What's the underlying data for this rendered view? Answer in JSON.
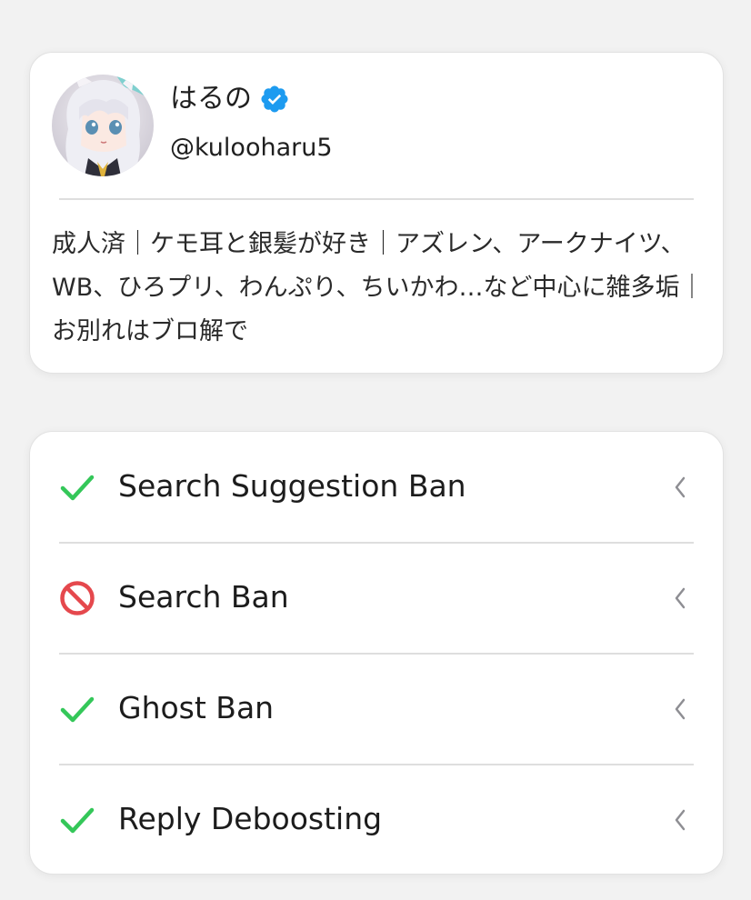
{
  "profile": {
    "display_name": "はるの",
    "handle": "@kulooharu5",
    "bio": "成人済｜ケモ耳と銀髪が好き｜アズレン、アークナイツ、WB、ひろプリ、わんぷり、ちいかわ…など中心に雑多垢｜お別れはブロ解で",
    "verified": true,
    "verified_color": "#1d9bf0"
  },
  "status_checks": [
    {
      "label": "Search Suggestion Ban",
      "status": "ok",
      "icon": "check-icon"
    },
    {
      "label": "Search Ban",
      "status": "banned",
      "icon": "prohibited-icon"
    },
    {
      "label": "Ghost Ban",
      "status": "ok",
      "icon": "check-icon"
    },
    {
      "label": "Reply Deboosting",
      "status": "ok",
      "icon": "check-icon"
    }
  ],
  "colors": {
    "ok": "#34c759",
    "banned": "#e5484d",
    "chevron": "#8e8e93"
  }
}
